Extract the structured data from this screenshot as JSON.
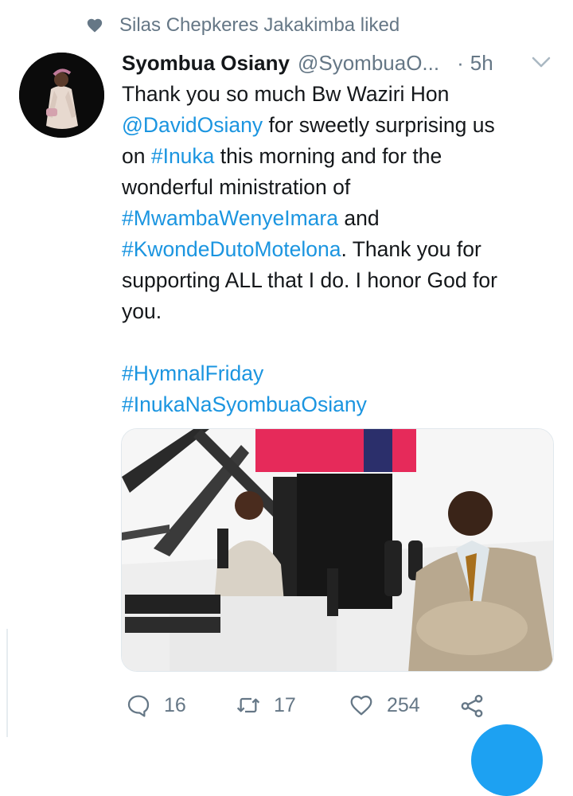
{
  "social_context": {
    "icon": "heart-icon",
    "text": "Silas Chepkeres Jakakimba liked"
  },
  "tweet": {
    "author_name": "Syombua Osiany",
    "author_handle": "@SyombuaO...",
    "separator": "·",
    "time": "5h",
    "text_lines": [
      {
        "parts": [
          {
            "t": "Thank you so much Bw Waziri Hon",
            "link": false
          }
        ]
      },
      {
        "parts": [
          {
            "t": "@DavidOsiany",
            "link": true
          },
          {
            "t": " for sweetly surprising us",
            "link": false
          }
        ]
      },
      {
        "parts": [
          {
            "t": "on ",
            "link": false
          },
          {
            "t": "#Inuka",
            "link": true
          },
          {
            "t": " this morning and for the",
            "link": false
          }
        ]
      },
      {
        "parts": [
          {
            "t": "wonderful ministration of",
            "link": false
          }
        ]
      },
      {
        "parts": [
          {
            "t": "#MwambaWenyeImara",
            "link": true
          },
          {
            "t": " and",
            "link": false
          }
        ]
      },
      {
        "parts": [
          {
            "t": "#KwondeDutoMotelona",
            "link": true
          },
          {
            "t": ". Thank you for",
            "link": false
          }
        ]
      },
      {
        "parts": [
          {
            "t": "supporting ALL that I do. I honor God for",
            "link": false
          }
        ]
      },
      {
        "parts": [
          {
            "t": "you.",
            "link": false
          }
        ]
      },
      {
        "parts": []
      },
      {
        "parts": [
          {
            "t": "#HymnalFriday",
            "link": true
          }
        ]
      },
      {
        "parts": [
          {
            "t": "#InukaNaSyombuaOsiany",
            "link": true
          }
        ]
      }
    ]
  },
  "actions": {
    "reply_count": "16",
    "retweet_count": "17",
    "like_count": "254"
  },
  "colors": {
    "link": "#1b95e0",
    "secondary": "#657786",
    "text": "#14171a",
    "fab": "#1da1f2"
  }
}
